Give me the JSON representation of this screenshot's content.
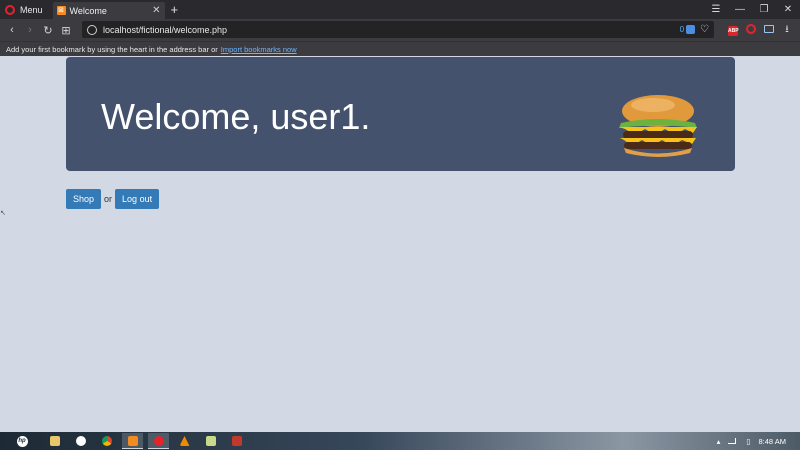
{
  "browser": {
    "menu_label": "Menu",
    "tab_title": "Welcome",
    "tab_favicon_glyph": "⊠",
    "new_tab_label": "+",
    "url": "localhost/fictional/welcome.php",
    "adblock_count": "0",
    "bookmark_prompt": "Add your first bookmark by using the heart in the address bar or",
    "bookmark_link": "Import bookmarks now",
    "extension_abp_label": "ABP",
    "icons": [
      "opera-logo",
      "back-arrow",
      "forward-arrow",
      "reload",
      "speed-dial-grid",
      "globe",
      "adblock-shield",
      "heart",
      "easy-setup",
      "minimize",
      "restore",
      "close",
      "download"
    ]
  },
  "page": {
    "heading": "Welcome, user1.",
    "shop_label": "Shop",
    "or_text": "or",
    "logout_label": "Log out",
    "colors": {
      "background": "#d2d8e4",
      "jumbotron": "#45526e",
      "button": "#337ab7"
    }
  },
  "taskbar": {
    "clock": "8:48 AM",
    "apps": [
      "file-explorer",
      "opera-gx",
      "chrome",
      "xampp",
      "opera",
      "vlc",
      "notepad",
      "app-red"
    ]
  }
}
